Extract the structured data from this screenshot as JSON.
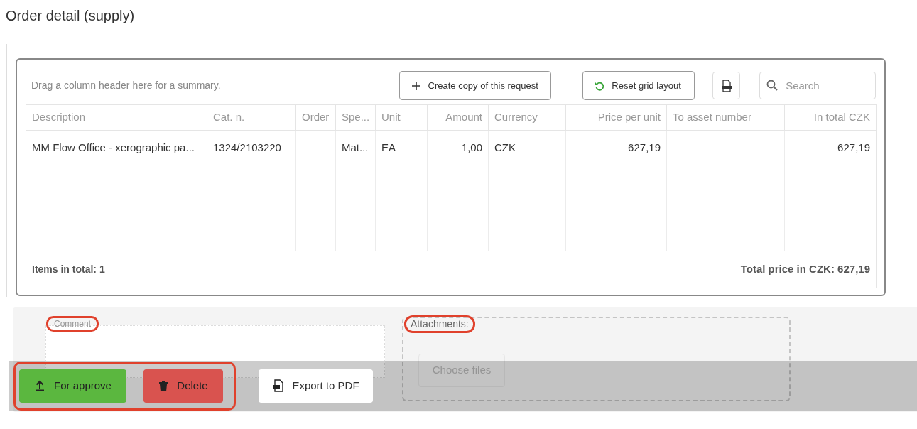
{
  "window": {
    "title": "Order detail (supply)"
  },
  "toolbar": {
    "group_hint": "Drag a column header here for a summary.",
    "buttons": [
      {
        "kind": "copy",
        "label": "Create copy of this request"
      },
      {
        "kind": "reset",
        "label": "Reset grid layout"
      }
    ],
    "search": {
      "placeholder": "Search"
    }
  },
  "table": {
    "columns": [
      {
        "label": "Description"
      },
      {
        "label": "Cat. n."
      },
      {
        "label": "Order"
      },
      {
        "label": "Spe..."
      },
      {
        "label": "Unit"
      },
      {
        "label": "Amount"
      },
      {
        "label": "Currency"
      },
      {
        "label": "Price per unit"
      },
      {
        "label": "To asset number"
      },
      {
        "label": "In total CZK"
      }
    ],
    "rows": [
      {
        "cells": [
          "MM Flow Office - xerographic pa...",
          "1324/2103220",
          "",
          "Mat...",
          "EA",
          "1,00",
          "CZK",
          "627,19",
          "",
          "627,19"
        ]
      }
    ],
    "footer": {
      "items_total": "Items in total: 1",
      "price_total": "Total price in CZK: 627,19"
    }
  },
  "comment": {
    "label": "Comment",
    "highlighted": true
  },
  "attachments": {
    "label": "Attachments:",
    "highlighted": true,
    "button": "Choose files"
  },
  "actions": {
    "highlighted": true,
    "buttons": [
      {
        "kind": "approve",
        "label": "For approve"
      },
      {
        "kind": "delete",
        "label": "Delete"
      },
      {
        "kind": "export",
        "label": "Export to PDF"
      }
    ]
  }
}
